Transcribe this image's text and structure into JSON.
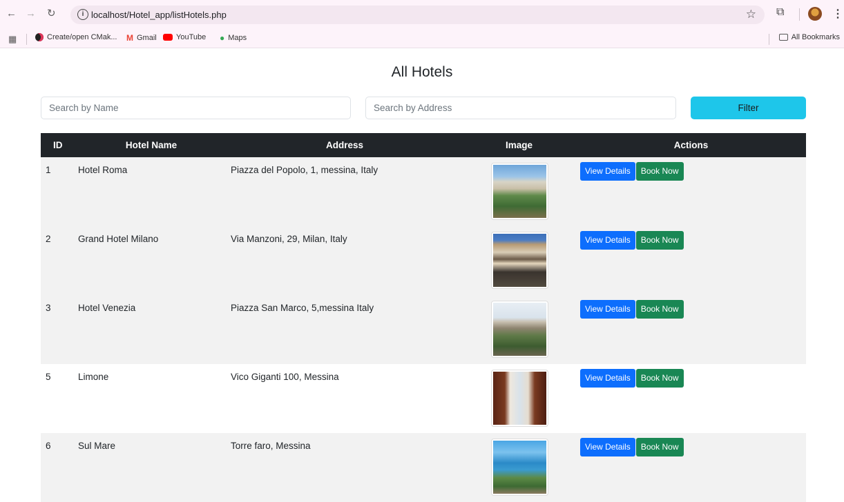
{
  "browser": {
    "url": "localhost/Hotel_app/listHotels.php",
    "bookmarks": [
      {
        "label": "Create/open CMak...",
        "color": "#d93025"
      },
      {
        "label": "Gmail",
        "color": "#ea4335"
      },
      {
        "label": "YouTube",
        "color": "#ff0000"
      },
      {
        "label": "Maps",
        "color": "#34a853"
      }
    ],
    "all_bookmarks": "All Bookmarks"
  },
  "page": {
    "title": "All Hotels",
    "search_name_placeholder": "Search by Name",
    "search_address_placeholder": "Search by Address",
    "filter_label": "Filter"
  },
  "table": {
    "headers": {
      "id": "ID",
      "name": "Hotel Name",
      "address": "Address",
      "image": "Image",
      "actions": "Actions"
    },
    "rows": [
      {
        "id": "1",
        "name": "Hotel Roma",
        "address": "Piazza del Popolo, 1, messina, Italy",
        "view": "View Details",
        "book": "Book Now"
      },
      {
        "id": "2",
        "name": "Grand Hotel Milano",
        "address": "Via Manzoni, 29, Milan, Italy",
        "view": "View Details",
        "book": "Book Now"
      },
      {
        "id": "3",
        "name": "Hotel Venezia",
        "address": "Piazza San Marco, 5,messina Italy",
        "view": "View Details",
        "book": "Book Now"
      },
      {
        "id": "5",
        "name": "Limone",
        "address": "Vico Giganti 100, Messina",
        "view": "View Details",
        "book": "Book Now"
      },
      {
        "id": "6",
        "name": "Sul Mare",
        "address": "Torre faro, Messina",
        "view": "View Details",
        "book": "Book Now"
      }
    ]
  },
  "colors": {
    "filter_button": "#1ec6ea",
    "view_button": "#0d6efd",
    "book_button": "#198754",
    "table_header": "#212529"
  }
}
